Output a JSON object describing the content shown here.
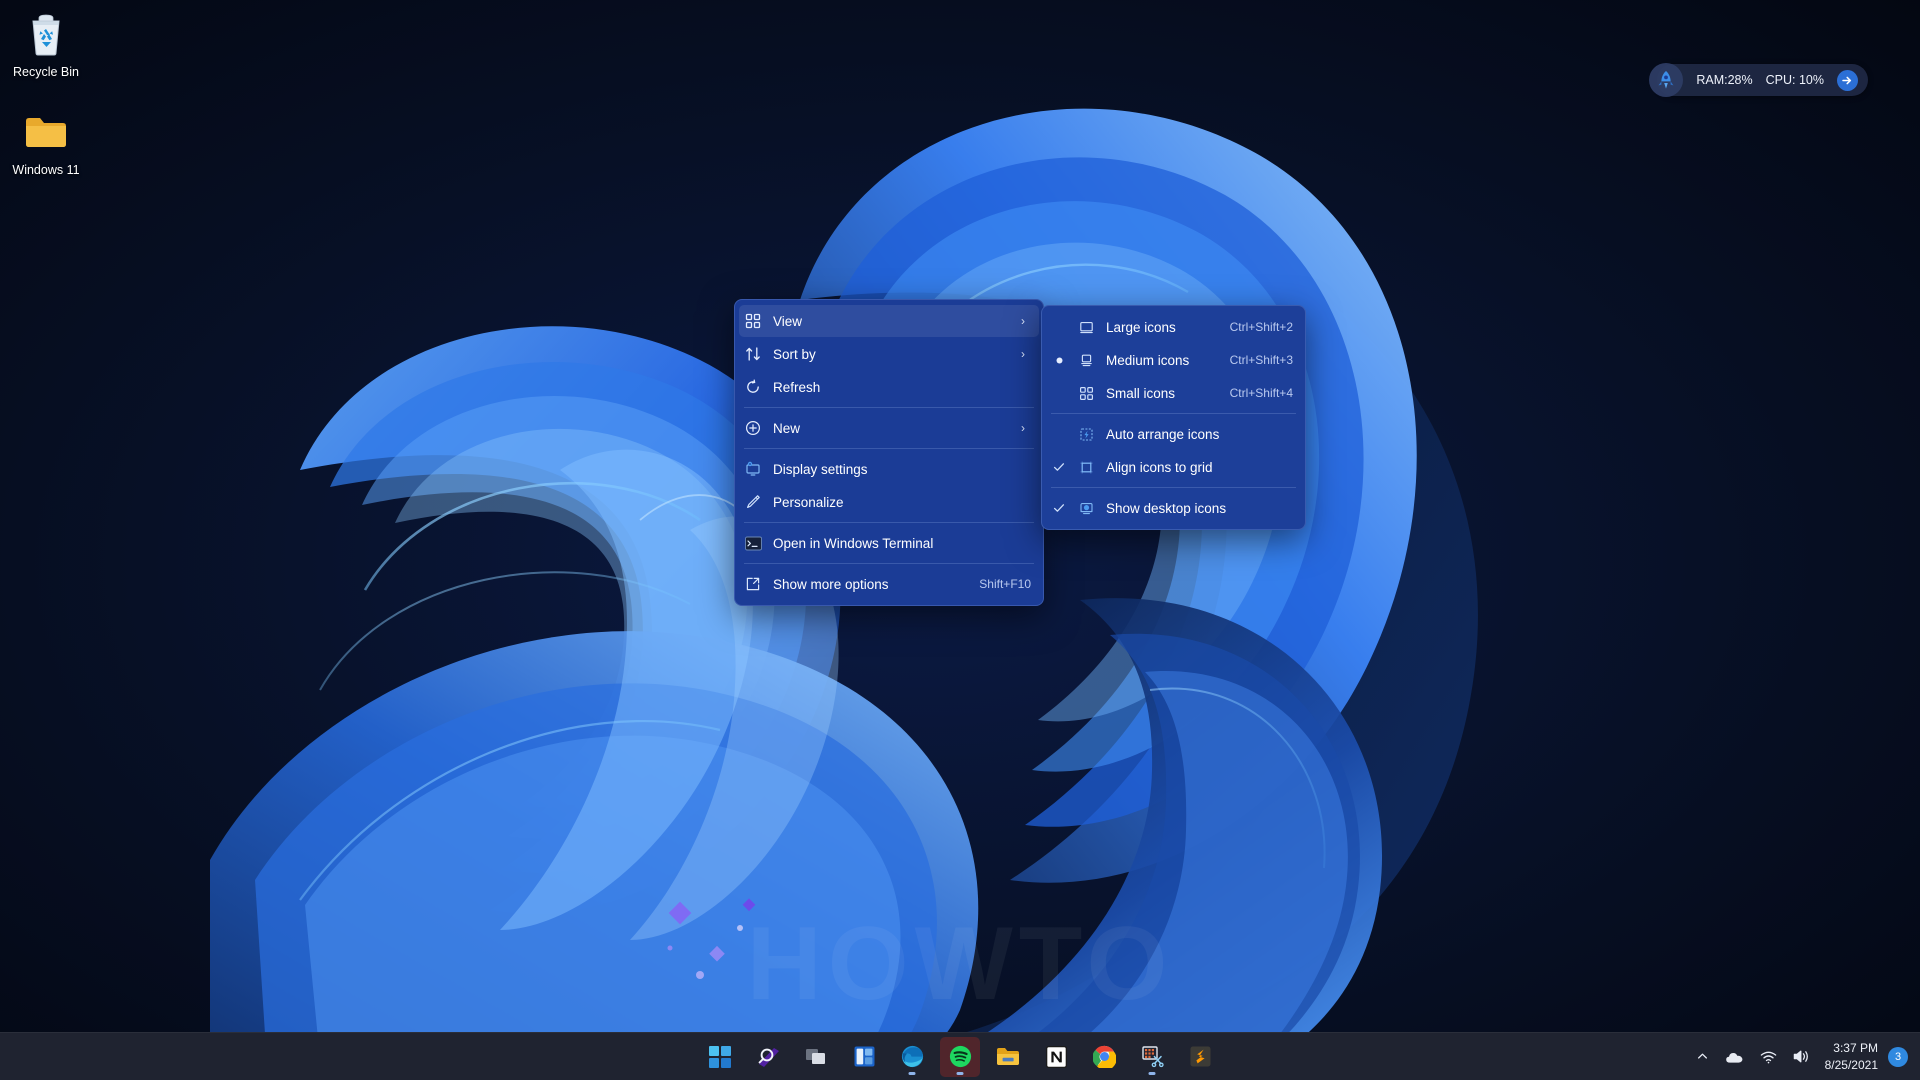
{
  "desktop": {
    "watermark": "HOWTO",
    "icons": [
      {
        "label": "Recycle Bin",
        "icon": "recycle-bin-icon"
      },
      {
        "label": "Windows 11",
        "icon": "folder-icon"
      }
    ]
  },
  "perf_gadget": {
    "ram_label": "RAM:28%",
    "cpu_label": "CPU: 10%",
    "rocket_icon": "rocket-icon",
    "arrow_icon": "arrow-right-icon",
    "accent": "#2b6fd6"
  },
  "context_menu": {
    "accent": "#1b3c96",
    "items": [
      {
        "label": "View",
        "icon": "grid-icon",
        "submenu": true,
        "accel": ""
      },
      {
        "label": "Sort by",
        "icon": "sort-arrows-icon",
        "submenu": true,
        "accel": ""
      },
      {
        "label": "Refresh",
        "icon": "refresh-icon",
        "submenu": false,
        "accel": ""
      },
      {
        "label": "New",
        "icon": "plus-circle-icon",
        "submenu": true,
        "accel": ""
      },
      {
        "label": "Display settings",
        "icon": "monitor-gear-icon",
        "submenu": false,
        "accel": ""
      },
      {
        "label": "Personalize",
        "icon": "paintbrush-icon",
        "submenu": false,
        "accel": ""
      },
      {
        "label": "Open in Windows Terminal",
        "icon": "terminal-icon",
        "submenu": false,
        "accel": ""
      },
      {
        "label": "Show more options",
        "icon": "expand-arrow-icon",
        "submenu": false,
        "accel": "Shift+F10"
      }
    ]
  },
  "view_submenu": {
    "accent": "#1d3f99",
    "items": [
      {
        "label": "Large icons",
        "icon": "large-icon-view-icon",
        "accel": "Ctrl+Shift+2",
        "state": "none"
      },
      {
        "label": "Medium icons",
        "icon": "medium-icon-view-icon",
        "accel": "Ctrl+Shift+3",
        "state": "radio"
      },
      {
        "label": "Small icons",
        "icon": "small-icon-view-icon",
        "accel": "Ctrl+Shift+4",
        "state": "none"
      },
      {
        "label": "Auto arrange icons",
        "icon": "auto-arrange-icon",
        "accel": "",
        "state": "none"
      },
      {
        "label": "Align icons to grid",
        "icon": "align-grid-icon",
        "accel": "",
        "state": "check"
      },
      {
        "label": "Show desktop icons",
        "icon": "show-desktop-icon",
        "accel": "",
        "state": "check"
      }
    ]
  },
  "taskbar": {
    "buttons": [
      {
        "name": "start-button",
        "label": "Start"
      },
      {
        "name": "search-button",
        "label": "Search"
      },
      {
        "name": "task-view-button",
        "label": "Task view"
      },
      {
        "name": "widgets-button",
        "label": "Widgets"
      },
      {
        "name": "edge-button",
        "label": "Microsoft Edge"
      },
      {
        "name": "spotify-button",
        "label": "Spotify"
      },
      {
        "name": "file-explorer-button",
        "label": "File Explorer"
      },
      {
        "name": "notion-button",
        "label": "Notion"
      },
      {
        "name": "chrome-button",
        "label": "Google Chrome"
      },
      {
        "name": "snipping-tool-button",
        "label": "Snipping Tool"
      },
      {
        "name": "sublime-text-button",
        "label": "Sublime Text"
      }
    ],
    "tray": {
      "chevron": "chevron-up-icon",
      "onedrive": "cloud-icon",
      "network": "wifi-icon",
      "volume": "speaker-icon",
      "time": "3:37 PM",
      "date": "8/25/2021",
      "notification_count": "3",
      "badge_color": "#2f89e0"
    }
  }
}
